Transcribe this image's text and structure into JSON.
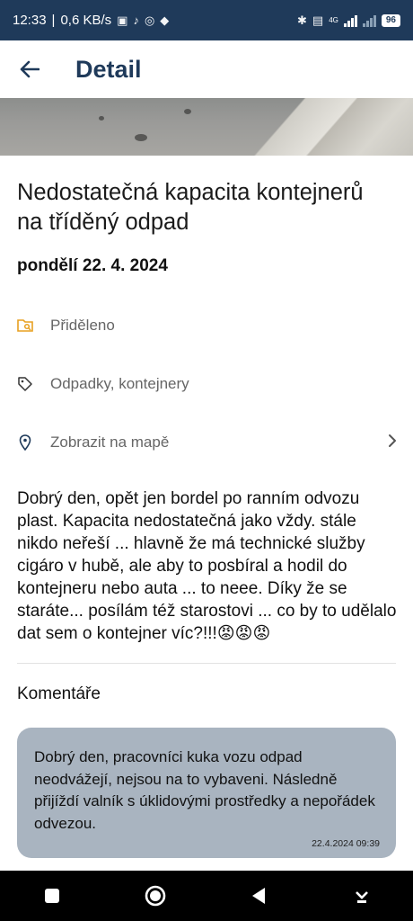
{
  "status_bar": {
    "time": "12:33",
    "speed": "0,6 KB/s",
    "network": "4G",
    "battery": "96"
  },
  "header": {
    "title": "Detail"
  },
  "report": {
    "title": "Nedostatečná kapacita kontejnerů na tříděný odpad",
    "date": "pondělí 22. 4. 2024",
    "status": "Přiděleno",
    "category": "Odpadky, kontejnery",
    "map_link": "Zobrazit na mapě",
    "description": "Dobrý den, opět jen bordel po ranním odvozu plast. Kapacita nedostatečná jako vždy. stále nikdo neřeší ... hlavně že má technické služby cigáro v hubě, ale aby to posbíral a hodil do kontejneru nebo auta ... to neee. Díky že se staráte... posílám též starostovi ... co by to udělalo dat sem o kontejner víc?!!!😡😡😡"
  },
  "comments": {
    "heading": "Komentáře",
    "items": [
      {
        "text": "Dobrý den, pracovníci kuka vozu odpad neodvážejí, nejsou na to vybaveni. Následně přijíždí valník s úklidovými prostředky a nepořádek odvezou.",
        "time": "22.4.2024 09:39"
      }
    ]
  },
  "icons": {
    "back": "arrow-left-icon",
    "status": "folder-search-icon",
    "category": "tag-icon",
    "map": "location-pin-icon",
    "chevron": "chevron-right-icon"
  },
  "colors": {
    "brand": "#1f3a5a",
    "status_icon": "#e8a020",
    "comment_bubble": "#a9b4c0"
  }
}
